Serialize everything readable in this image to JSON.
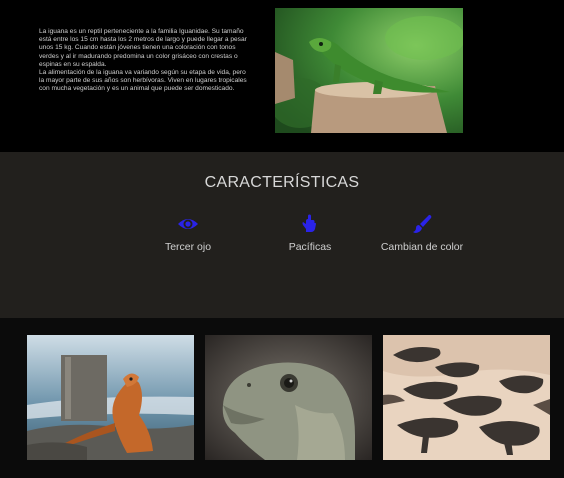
{
  "intro": {
    "paragraphs": [
      "La iguana es un reptil perteneciente a la familia Iguanidae. Su tamaño está entre los 15 cm hasta los 2 metros de largo y puede llegar a pesar unos 15 kg. Cuando están jóvenes tienen una coloración con tonos verdes y al ir madurando predomina un color grisáceo con crestas o espinas en su espalda.",
      "La alimentación de la iguana va variando según su etapa de vida, pero la mayor parte de sus años son herbívoras. Viven en lugares tropicales con mucha vegetación y es un animal que puede ser domesticado."
    ]
  },
  "features": {
    "title": "CARACTERÍSTICAS",
    "items": [
      {
        "label": "Tercer ojo",
        "icon": "eye-icon"
      },
      {
        "label": "Pacíficas",
        "icon": "hand-icon"
      },
      {
        "label": "Cambian de color",
        "icon": "paint-brush-icon"
      }
    ],
    "icon_color": "#2a23e8"
  },
  "colors": {
    "intro_bg": "#000000",
    "features_bg": "#22201d",
    "gallery_bg": "#0b0b0b"
  }
}
